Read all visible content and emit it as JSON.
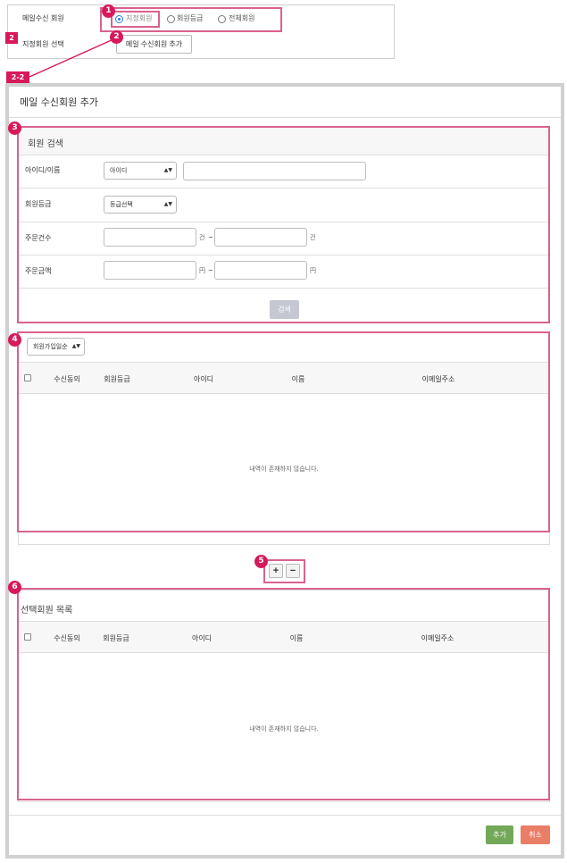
{
  "top": {
    "row1_label": "메일수신 회원",
    "row2_label": "지정회원 선택",
    "radios": [
      {
        "label": "지정회원",
        "checked": true
      },
      {
        "label": "회원등급",
        "checked": false
      },
      {
        "label": "전체회원",
        "checked": false
      }
    ],
    "add_button": "메일 수신회원 추가"
  },
  "badges": {
    "b1": "1",
    "b2": "2",
    "b2sq": "2",
    "b22": "2-2",
    "b3": "3",
    "b4": "4",
    "b5": "5",
    "b6": "6"
  },
  "modal": {
    "title": "메일 수신회원 추가",
    "search": {
      "header": "회원 검색",
      "id_label": "아이디/이름",
      "id_select": "아이디",
      "grade_label": "회원등급",
      "grade_select": "등급선택",
      "orders_label": "주문건수",
      "orders_unit": "건",
      "amount_label": "주문금액",
      "amount_unit": "円",
      "tilde": "~",
      "search_button": "검색"
    },
    "results": {
      "sort_select": "회원가입일순",
      "columns": [
        "수신동의",
        "회원등급",
        "아이디",
        "이름",
        "이메일주소"
      ],
      "empty": "내역이 존재하지 않습니다."
    },
    "controls": {
      "plus": "+",
      "minus": "−"
    },
    "selected": {
      "header": "선택회원 목록",
      "columns": [
        "수신동의",
        "회원등급",
        "아이디",
        "이름",
        "이메일주소"
      ],
      "empty": "내역이 존재하지 않습니다."
    },
    "footer": {
      "add": "추가",
      "cancel": "취소"
    }
  },
  "colors": {
    "annotation": "#d7195b",
    "annotation_border": "#d9628f",
    "add_button": "#73a858",
    "cancel_button": "#ea7d66",
    "search_button": "#c5c7d3"
  }
}
